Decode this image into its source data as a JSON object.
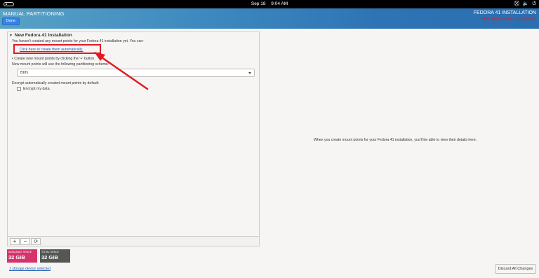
{
  "topbar": {
    "date": "Sep 18",
    "time": "9:04 AM",
    "tray_icons": [
      "network-icon",
      "volume-icon",
      "power-icon"
    ]
  },
  "header": {
    "spoke_title": "MANUAL PARTITIONING",
    "done_label": "Done",
    "product_title": "FEDORA 41 INSTALLATION",
    "prerelease_label": "PRE-RELEASE / TESTING"
  },
  "left_panel": {
    "install_title": "New Fedora 41 Installation",
    "info_text": "You haven't created any mount points for your Fedora 41 installation yet.  You can:",
    "auto_link": "Click here to create them automatically.",
    "manual_text": "• Create new mount points by clicking the '+' button.",
    "scheme_text": "New mount points will use the following partitioning scheme:",
    "scheme_value": "Btrfs",
    "encrypt_text": "Encrypt automatically created mount points by default:",
    "encrypt_label": "Encrypt my data.",
    "encrypt_checked": false,
    "toolbar": {
      "add": "+",
      "remove": "−",
      "reload": "⟳"
    }
  },
  "right_panel": {
    "message": "When you create mount points for your Fedora 41 installation, you'll be able to view their details here."
  },
  "space": {
    "available_label": "AVAILABLE SPACE",
    "available_value": "32 GiB",
    "total_label": "TOTAL SPACE",
    "total_value": "32 GiB"
  },
  "footer": {
    "storage_link": "1 storage device selected",
    "discard_label": "Discard All Changes"
  },
  "colors": {
    "header_start": "#58a2c6",
    "header_end": "#2a6fb0",
    "done_button": "#3584e4",
    "annotation_red": "#e01b24",
    "available_space": "#d6336c",
    "total_space": "#555753",
    "link": "#1a5fb4"
  }
}
